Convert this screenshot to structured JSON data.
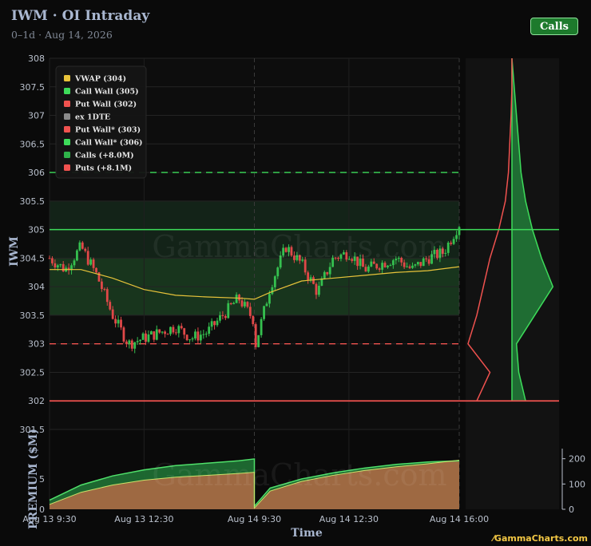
{
  "header": {
    "title": "IWM · OI Intraday",
    "subtitle": "0–1d · Aug 14, 2026",
    "calls_button": "Calls"
  },
  "branding": "GammaCharts.com",
  "watermark": "GammaCharts.com",
  "colors": {
    "background": "#0a0a0a",
    "call": "#3ddc5a",
    "put": "#f0524f",
    "vwap": "#e8c33a",
    "calls_fill": "#1f6d33",
    "puts_fill": "#b56a45"
  },
  "chart_data": {
    "type": "line",
    "ylabel": "IWM",
    "xlabel": "Time",
    "ylim": [
      301.5,
      308
    ],
    "yticks": [
      "308",
      "307.5",
      "307",
      "306.5",
      "306",
      "305.5",
      "305",
      "304.5",
      "304",
      "303.5",
      "303",
      "302.5",
      "302",
      "301.5"
    ],
    "xticks": [
      "Aug 13 9:30",
      "Aug 13 12:30",
      "Aug 14 9:30",
      "Aug 14 12:30",
      "Aug 14 16:00"
    ],
    "legend": {
      "placement": "top-left",
      "entries": [
        {
          "label": "VWAP (304)",
          "color": "#e8c33a"
        },
        {
          "label": "Call Wall (305)",
          "color": "#3ddc5a"
        },
        {
          "label": "Put Wall (302)",
          "color": "#f0524f"
        },
        {
          "label": "ex 1DTE",
          "color": "#8a8a8a"
        },
        {
          "label": "Put Wall* (303)",
          "color": "#f0524f"
        },
        {
          "label": "Call Wall* (306)",
          "color": "#3ddc5a"
        },
        {
          "label": "Calls (+8.0M)",
          "color": "#2fb34a"
        },
        {
          "label": "Puts (+8.1M)",
          "color": "#f0524f"
        }
      ]
    },
    "levels": {
      "call_wall": 305,
      "put_wall": 302,
      "call_wall_ex1dte": 306,
      "put_wall_ex1dte": 303
    },
    "zones": [
      {
        "from": 303.5,
        "to": 304.5
      },
      {
        "from": 304.5,
        "to": 305.5
      }
    ],
    "price": {
      "x": [
        0,
        0.5,
        1,
        1.5,
        2,
        2.5,
        3,
        3.5,
        4,
        4.5,
        5,
        5.5,
        6,
        6.5,
        6.5,
        7,
        7.5,
        8,
        8.5,
        9,
        9.5,
        10,
        10.5,
        11,
        11.5,
        12,
        12.5,
        13
      ],
      "y": [
        304.5,
        304.3,
        304.7,
        304.2,
        303.5,
        303.0,
        303.1,
        303.2,
        303.3,
        303.1,
        303.2,
        303.5,
        303.8,
        303.4,
        302.9,
        304.0,
        304.7,
        304.4,
        303.9,
        304.5,
        304.6,
        304.3,
        304.4,
        304.5,
        304.3,
        304.5,
        304.6,
        305.1
      ]
    },
    "vwap": {
      "x": [
        0,
        1,
        2,
        3,
        4,
        5,
        6,
        6.5,
        7,
        8,
        9,
        10,
        11,
        12,
        13
      ],
      "y": [
        304.3,
        304.3,
        304.15,
        303.95,
        303.85,
        303.82,
        303.8,
        303.78,
        303.9,
        304.1,
        304.15,
        304.2,
        304.25,
        304.28,
        304.35
      ]
    },
    "x_ticks_at": [
      0,
      3,
      6.5,
      9.5,
      13
    ],
    "premium": {
      "ylabel": "PREMIUM ($M)",
      "left_ticks": [
        "0",
        "5"
      ],
      "right_ticks": [
        "0",
        "100",
        "200"
      ],
      "ylim_left": [
        0,
        10
      ],
      "ylim_right": [
        0,
        240
      ],
      "calls": {
        "x": [
          0,
          1,
          2,
          3,
          4,
          5,
          6,
          6.5,
          6.5,
          7,
          8,
          9,
          10,
          11,
          12,
          13
        ],
        "y": [
          1.5,
          4.0,
          5.5,
          6.5,
          7.2,
          7.6,
          8.0,
          8.3,
          0.5,
          3.5,
          5.0,
          6.0,
          6.8,
          7.4,
          7.8,
          8.0
        ]
      },
      "puts": {
        "x": [
          0,
          1,
          2,
          3,
          4,
          5,
          6,
          6.5,
          6.5,
          7,
          8,
          9,
          10,
          11,
          12,
          13
        ],
        "y": [
          0.8,
          2.8,
          4.0,
          4.8,
          5.3,
          5.6,
          5.9,
          6.1,
          0.2,
          3.0,
          4.6,
          5.6,
          6.4,
          7.0,
          7.5,
          8.1
        ]
      }
    },
    "oi_profile": {
      "strikes": [
        308,
        307.5,
        307,
        306.5,
        306,
        305.5,
        305,
        304.5,
        304,
        303.5,
        303,
        302.5,
        302
      ],
      "calls": [
        0,
        0.5,
        1,
        1.5,
        2,
        3,
        4.5,
        6.5,
        9,
        5,
        1,
        1.5,
        3
      ],
      "puts": [
        0,
        0,
        0.2,
        0.5,
        0.8,
        1.5,
        3,
        5,
        6.5,
        8,
        10,
        5,
        8
      ]
    }
  }
}
